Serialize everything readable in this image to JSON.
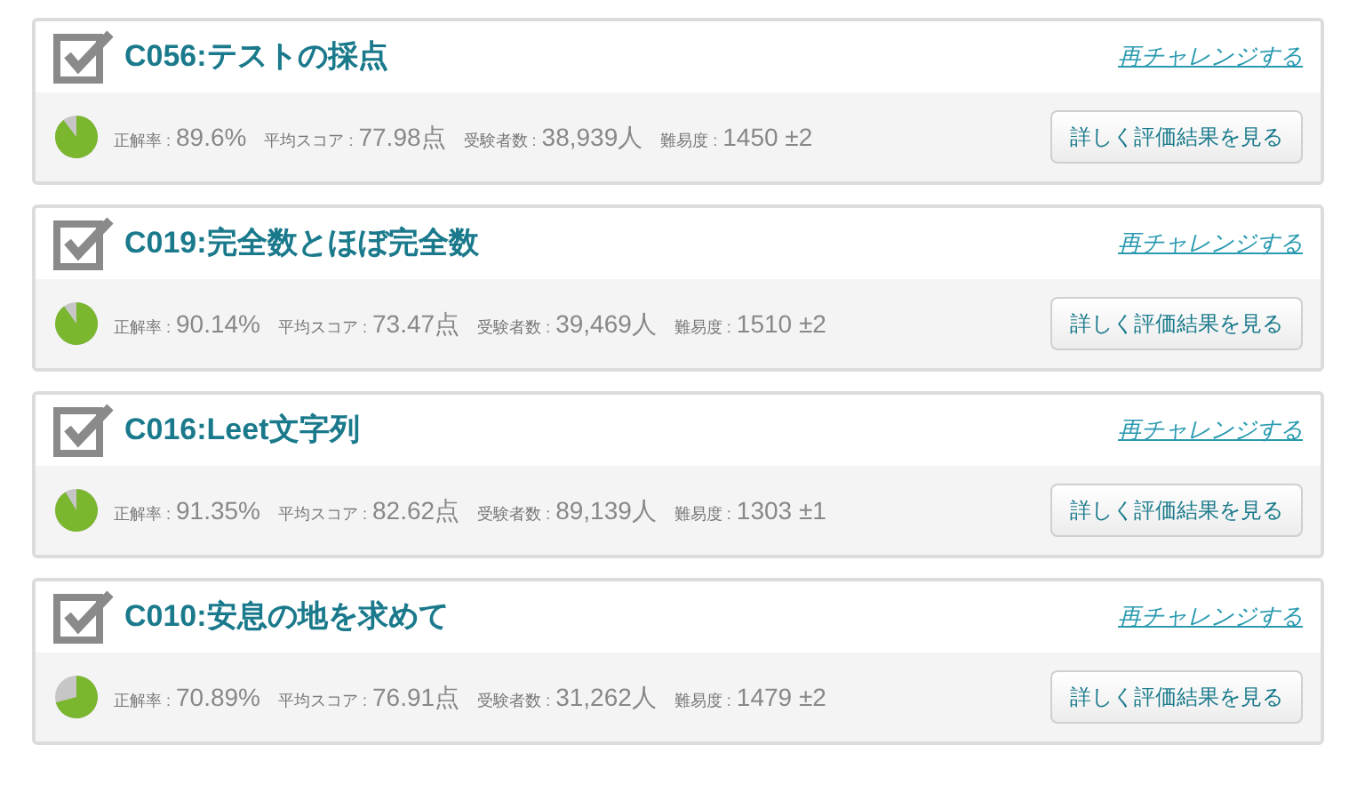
{
  "problems": [
    {
      "title": "C056:テストの採点",
      "retry_link": "再チャレンジする",
      "stats": [
        {
          "label": "正解率 :",
          "value": "89.6%"
        },
        {
          "label": "平均スコア :",
          "value": "77.98点"
        },
        {
          "label": "受験者数 :",
          "value": "38,939人"
        },
        {
          "label": "難易度 :",
          "value": "1450 ±2"
        }
      ],
      "details_button": "詳しく評価結果を見る"
    },
    {
      "title": "C019:完全数とほぼ完全数",
      "retry_link": "再チャレンジする",
      "stats": [
        {
          "label": "正解率 :",
          "value": "90.14%"
        },
        {
          "label": "平均スコア :",
          "value": "73.47点"
        },
        {
          "label": "受験者数 :",
          "value": "39,469人"
        },
        {
          "label": "難易度 :",
          "value": "1510 ±2"
        }
      ],
      "details_button": "詳しく評価結果を見る"
    },
    {
      "title": "C016:Leet文字列",
      "retry_link": "再チャレンジする",
      "stats": [
        {
          "label": "正解率 :",
          "value": "91.35%"
        },
        {
          "label": "平均スコア :",
          "value": "82.62点"
        },
        {
          "label": "受験者数 :",
          "value": "89,139人"
        },
        {
          "label": "難易度 :",
          "value": "1303 ±1"
        }
      ],
      "details_button": "詳しく評価結果を見る"
    },
    {
      "title": "C010:安息の地を求めて",
      "retry_link": "再チャレンジする",
      "stats": [
        {
          "label": "正解率 :",
          "value": "70.89%"
        },
        {
          "label": "平均スコア :",
          "value": "76.91点"
        },
        {
          "label": "受験者数 :",
          "value": "31,262人"
        },
        {
          "label": "難易度 :",
          "value": "1479 ±2"
        }
      ],
      "details_button": "詳しく評価結果を見る"
    }
  ]
}
